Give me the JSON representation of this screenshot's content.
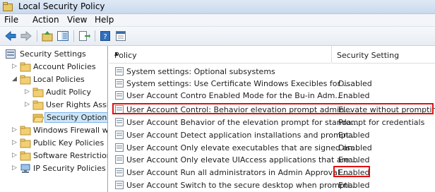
{
  "window": {
    "title": "Local Security Policy"
  },
  "menu": [
    "File",
    "Action",
    "View",
    "Help"
  ],
  "toolbar": {
    "buttons": [
      "back-arrow-icon",
      "forward-arrow-icon",
      "up-folder-icon",
      "show-hide-tree-icon",
      "export-list-icon",
      "help-icon",
      "properties-icon"
    ]
  },
  "tree": {
    "items": [
      {
        "label": "Security Settings",
        "icon": "security-settings-icon"
      },
      {
        "label": "Account Policies",
        "icon": "folder-icon"
      },
      {
        "label": "Local Policies",
        "icon": "folder-icon"
      },
      {
        "label": "Audit Policy",
        "icon": "folder-icon"
      },
      {
        "label": "User Rights Assig",
        "icon": "folder-icon"
      },
      {
        "label": "Security Options",
        "icon": "folder-open-icon"
      },
      {
        "label": "Windows Firewall wit",
        "icon": "folder-icon"
      },
      {
        "label": "Public Key Policies",
        "icon": "folder-icon"
      },
      {
        "label": "Software Restriction",
        "icon": "folder-icon"
      },
      {
        "label": "IP Security Policies o",
        "icon": "ip-security-icon"
      }
    ]
  },
  "list": {
    "columns": {
      "policy": "Policy",
      "setting": "Security Setting"
    },
    "rows": [
      {
        "policy": "System settings: Optional subsystems",
        "setting": ""
      },
      {
        "policy": "System settings: Use Certificate    Windows Execibles for ...",
        "setting": "Disabled"
      },
      {
        "policy": "User Account Contro Enabled    Mode for the Bu-in Adm...",
        "setting": "Enabled"
      },
      {
        "policy": "User Account Control: Behavior elevation prompt admin...",
        "setting": "Elevate without prompting"
      },
      {
        "policy": "User Account    Behavior of the elevation prompt for standa...",
        "setting": "Prompt for credentials"
      },
      {
        "policy": "User Account    Detect application installations and prompt...",
        "setting": "Enabled"
      },
      {
        "policy": "User Account    Only elevate executables that are signed an...",
        "setting": "Disabled"
      },
      {
        "policy": "User Account    Only elevate UIAccess applications that are ...",
        "setting": "Enabled"
      },
      {
        "policy": "User Account    Run all administrators in Admin Approval ...",
        "setting": "Enabled"
      },
      {
        "policy": "User Account    Switch to the secure desktop when prompti...",
        "setting": "Enabled"
      }
    ]
  },
  "colors": {
    "highlight_border": "#e01010",
    "selection_bg": "#cde6f7"
  }
}
